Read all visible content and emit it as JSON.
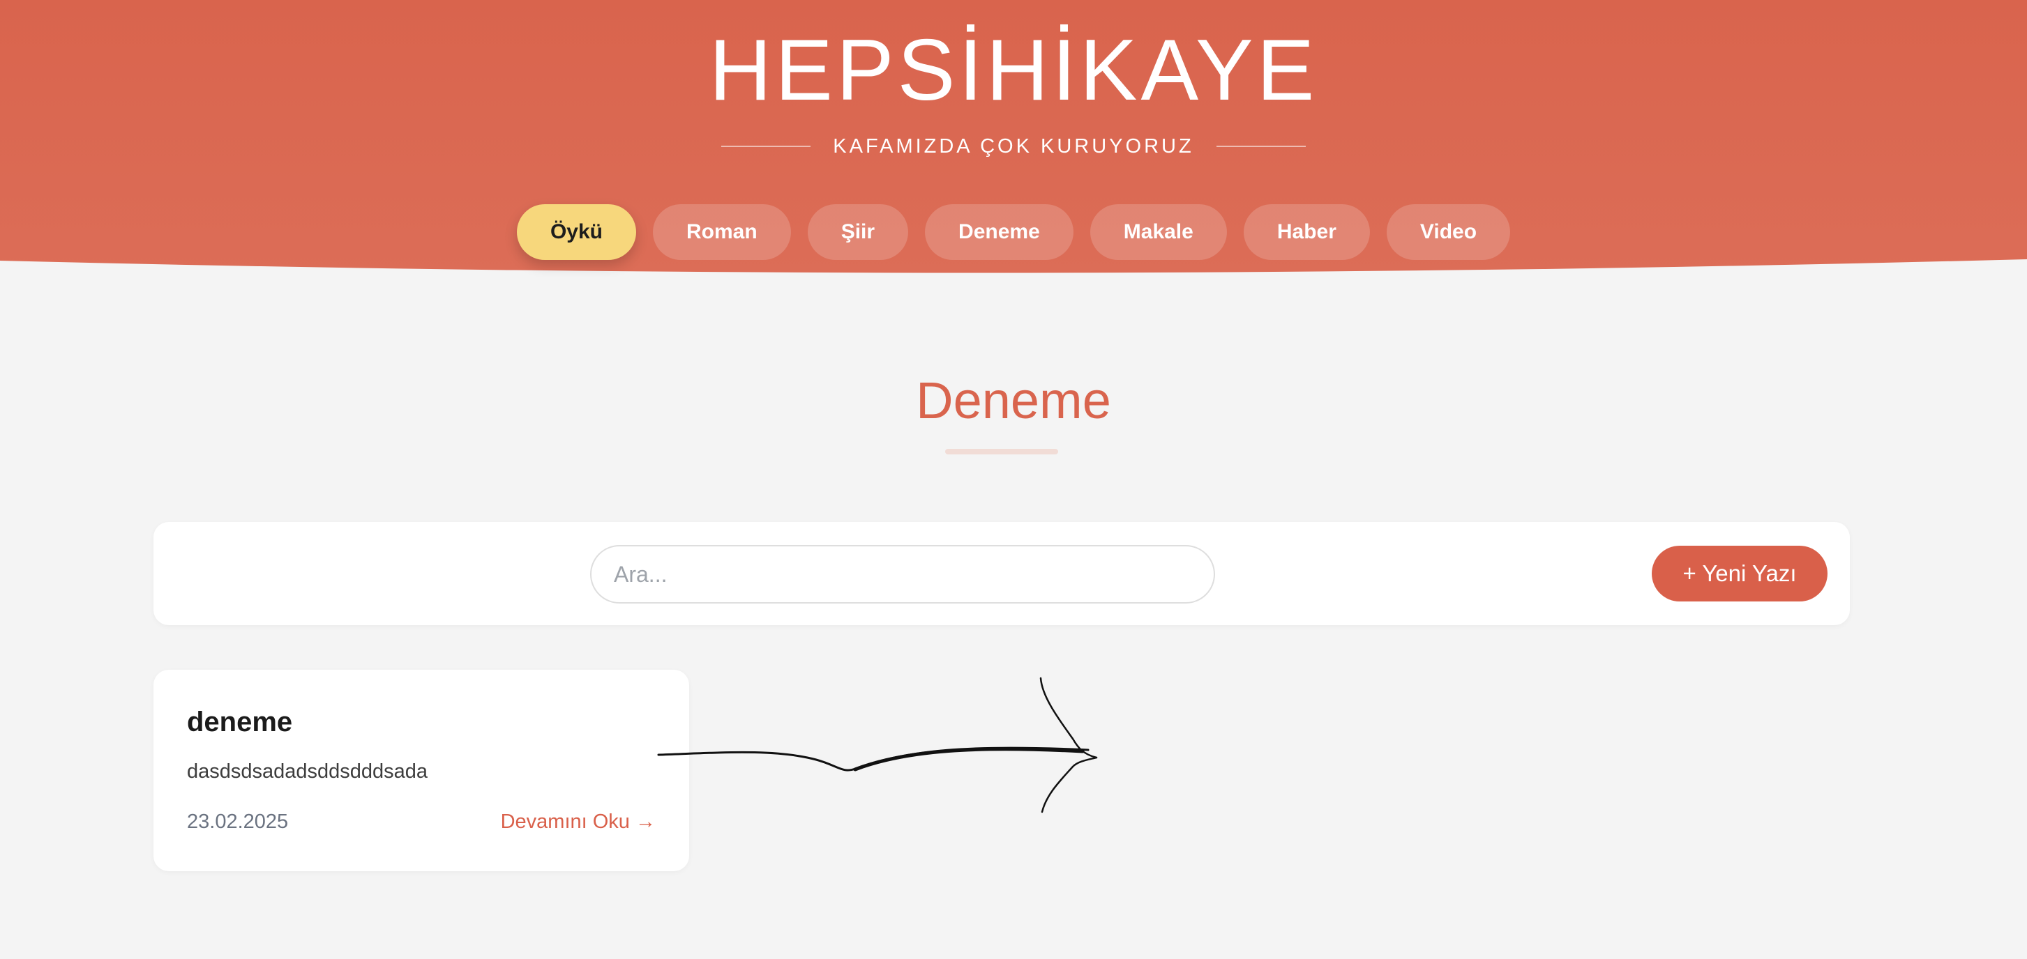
{
  "header": {
    "title": "HEPSİHİKAYE",
    "tagline": "KAFAMIZDA ÇOK KURUYORUZ",
    "background_color": "#d9644d",
    "nav": [
      {
        "label": "Öykü",
        "active": true
      },
      {
        "label": "Roman",
        "active": false
      },
      {
        "label": "Şiir",
        "active": false
      },
      {
        "label": "Deneme",
        "active": false
      },
      {
        "label": "Makale",
        "active": false
      },
      {
        "label": "Haber",
        "active": false
      },
      {
        "label": "Video",
        "active": false
      }
    ]
  },
  "section": {
    "title": "Deneme",
    "accent_color": "#d9644d"
  },
  "toolbar": {
    "search_placeholder": "Ara...",
    "search_value": "",
    "new_post_label": "+ Yeni Yazı"
  },
  "posts": [
    {
      "title": "deneme",
      "excerpt": "dasdsdsadadsddsdddsada",
      "date": "23.02.2025",
      "read_more": "Devamını Oku →"
    }
  ]
}
